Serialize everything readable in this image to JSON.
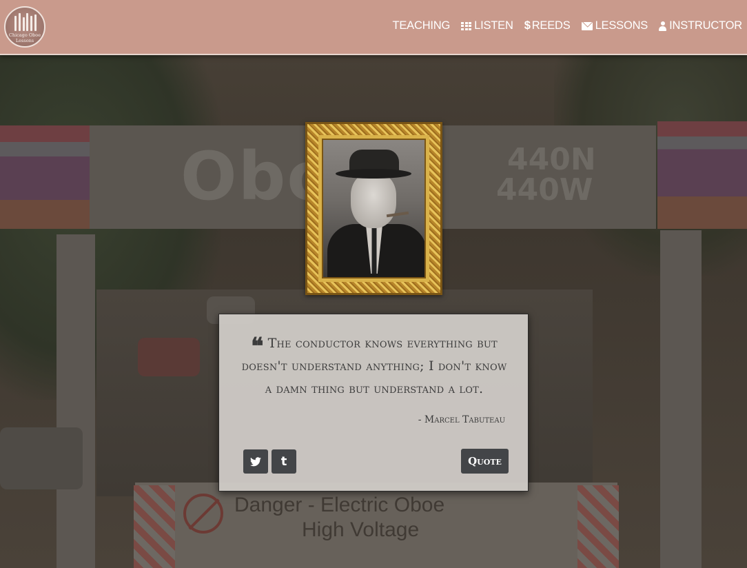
{
  "logo": {
    "line1": "Chicago Oboe",
    "line2": "Lessons"
  },
  "nav": {
    "items": [
      {
        "label": "TEACHING",
        "icon": ""
      },
      {
        "label": "LISTEN",
        "icon": "grid-icon"
      },
      {
        "label": "REEDS",
        "icon": "dollar-icon"
      },
      {
        "label": "LESSONS",
        "icon": "envelope-icon"
      },
      {
        "label": "INSTRUCTOR",
        "icon": "user-icon"
      }
    ]
  },
  "background": {
    "sign_main": "Obo",
    "sign_code1": "440N",
    "sign_code2": "440W",
    "danger_line1": "Danger -  Electric Oboe",
    "danger_line2": "High Voltage"
  },
  "quote": {
    "mark": "❝",
    "text": "The conductor knows everything but doesn't understand anything; I don't know a damn thing but understand a lot.",
    "author": "- Marcel Tabuteau",
    "button_label": "Quote",
    "share_twitter_icon": "twitter-icon",
    "share_tumblr_icon": "tumblr-icon",
    "tumblr_glyph": "t"
  },
  "colors": {
    "navbar": "#c99a8c",
    "button": "#434548",
    "card": "#d0ccc8"
  }
}
